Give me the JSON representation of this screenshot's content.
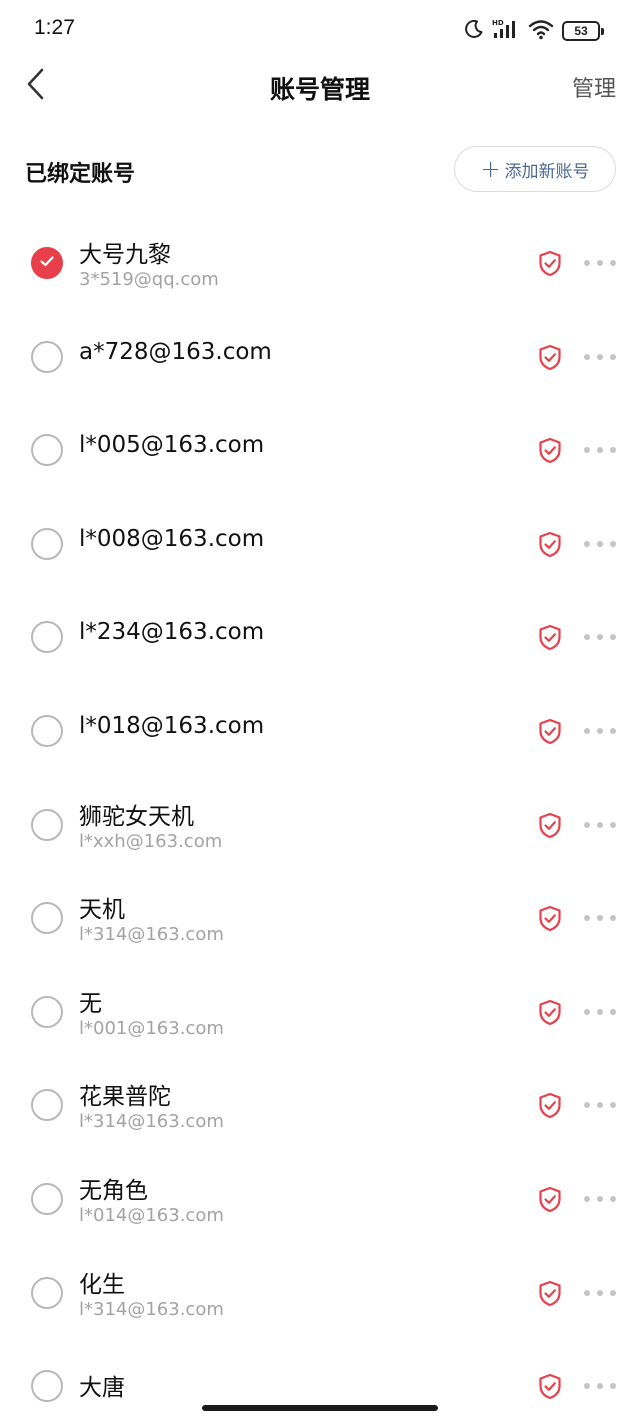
{
  "status_bar": {
    "time": "1:27",
    "battery": "53",
    "icons": [
      "moon-icon",
      "hd-signal-icon",
      "wifi-icon",
      "battery-icon"
    ]
  },
  "nav": {
    "title": "账号管理",
    "manage_label": "管理"
  },
  "section": {
    "title": "已绑定账号",
    "add_label": "添加新账号"
  },
  "colors": {
    "accent": "#e8404a",
    "link": "#4b6a8f",
    "secondary_text": "#a3a3a3"
  },
  "accounts": [
    {
      "name": "大号九黎",
      "email": "3*519@qq.com",
      "selected": true
    },
    {
      "name": "a*728@163.com",
      "email": "",
      "selected": false
    },
    {
      "name": "l*005@163.com",
      "email": "",
      "selected": false
    },
    {
      "name": "l*008@163.com",
      "email": "",
      "selected": false
    },
    {
      "name": "l*234@163.com",
      "email": "",
      "selected": false
    },
    {
      "name": "l*018@163.com",
      "email": "",
      "selected": false
    },
    {
      "name": "狮驼女天机",
      "email": "l*xxh@163.com",
      "selected": false
    },
    {
      "name": "天机",
      "email": "l*314@163.com",
      "selected": false
    },
    {
      "name": "无",
      "email": "l*001@163.com",
      "selected": false
    },
    {
      "name": "花果普陀",
      "email": "l*314@163.com",
      "selected": false
    },
    {
      "name": "无角色",
      "email": "l*014@163.com",
      "selected": false
    },
    {
      "name": "化生",
      "email": "l*314@163.com",
      "selected": false
    },
    {
      "name": "大唐",
      "email": "",
      "selected": false
    }
  ]
}
